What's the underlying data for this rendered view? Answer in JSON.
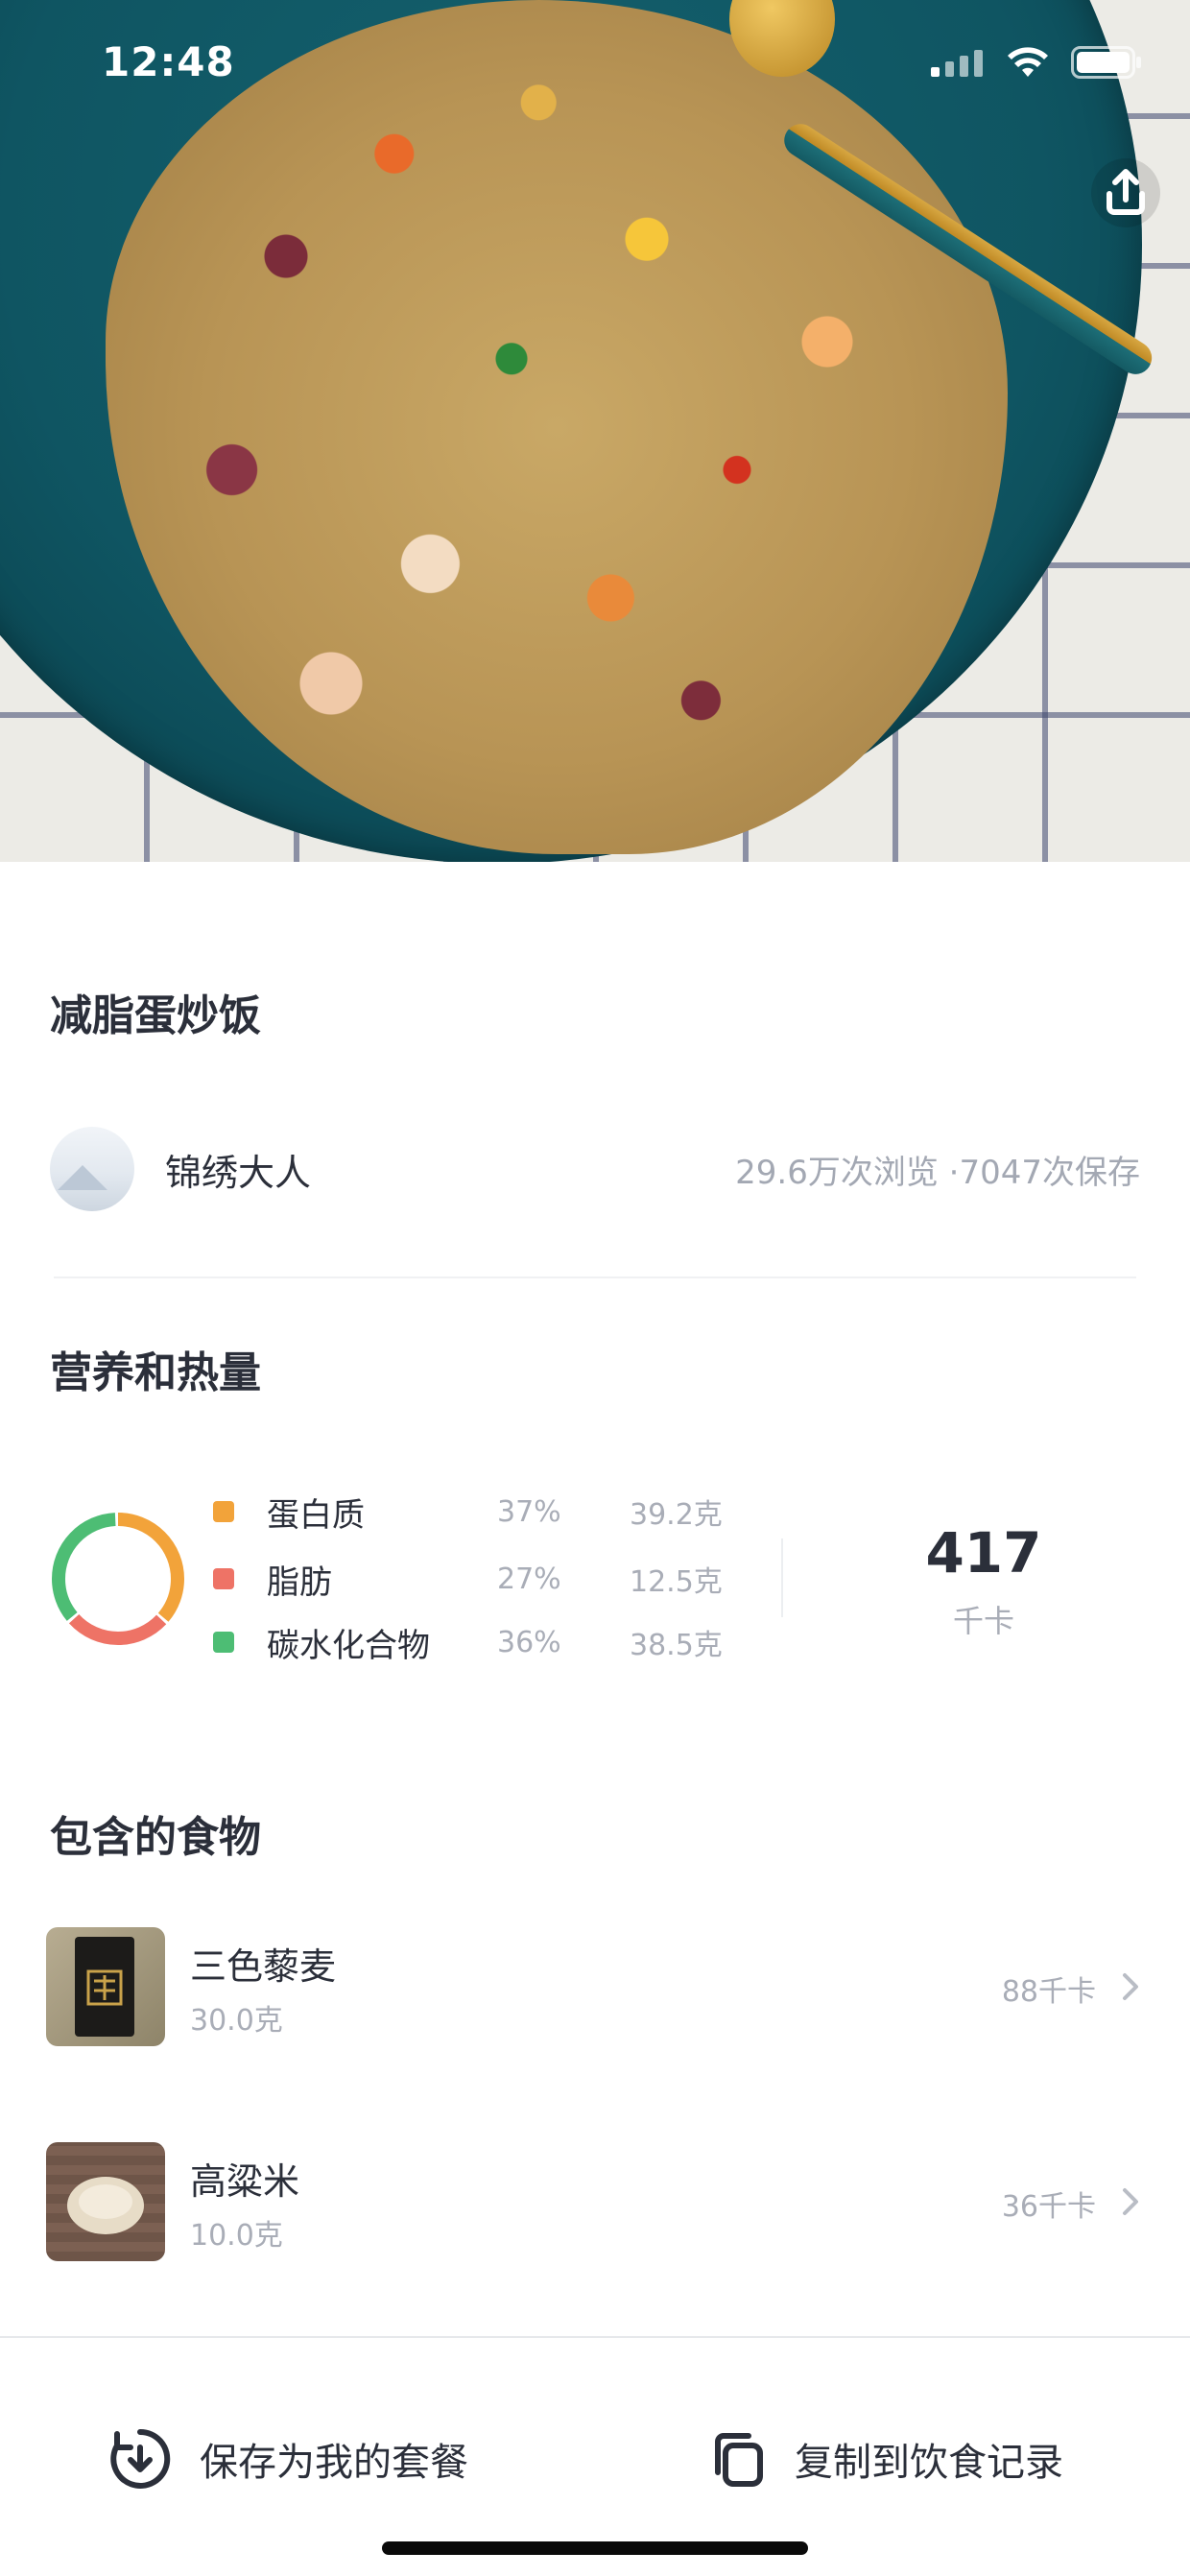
{
  "status_bar": {
    "time": "12:48"
  },
  "recipe": {
    "title": "减脂蛋炒饭",
    "author": "锦绣大人",
    "stats": "29.6万次浏览 ·7047次保存"
  },
  "nutrition": {
    "section_title": "营养和热量",
    "items": [
      {
        "name": "蛋白质",
        "percent": "37%",
        "amount": "39.2克",
        "color": "#f2a33a",
        "share": 0.37
      },
      {
        "name": "脂肪",
        "percent": "27%",
        "amount": "12.5克",
        "color": "#ee7366",
        "share": 0.27
      },
      {
        "name": "碳水化合物",
        "percent": "36%",
        "amount": "38.5克",
        "color": "#4dbd74",
        "share": 0.36
      }
    ],
    "calories": "417",
    "calories_unit": "千卡"
  },
  "foods": {
    "section_title": "包含的食物",
    "items": [
      {
        "name": "三色藜麦",
        "weight": "30.0克",
        "kcal": "88千卡"
      },
      {
        "name": "高粱米",
        "weight": "10.0克",
        "kcal": "36千卡"
      }
    ]
  },
  "actions": {
    "save_label": "保存为我的套餐",
    "copy_label": "复制到饮食记录"
  },
  "icons": {
    "share": "share-icon",
    "save": "save-meal-icon",
    "copy": "copy-icon",
    "chevron": "chevron-right-icon"
  }
}
